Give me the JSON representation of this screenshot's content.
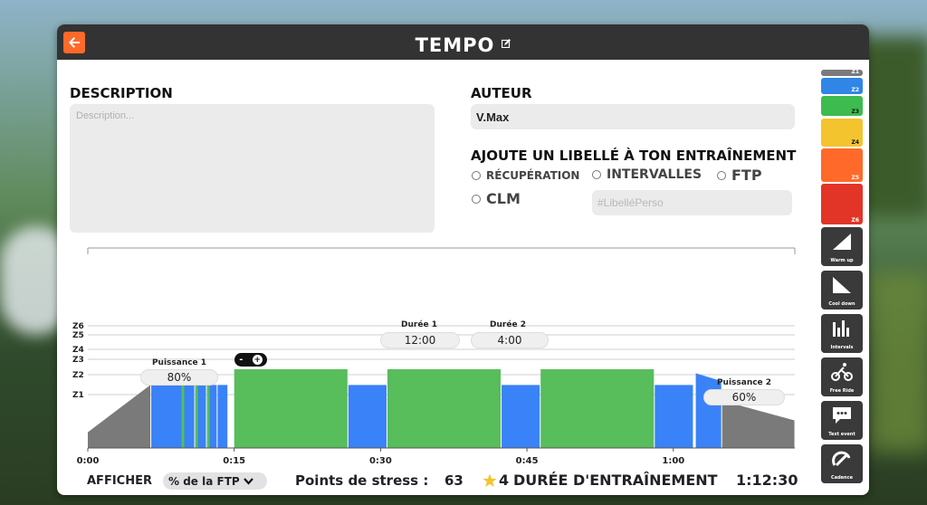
{
  "window": {
    "title": "TEMPO"
  },
  "description": {
    "label": "DESCRIPTION",
    "placeholder": "Description...",
    "value": ""
  },
  "author": {
    "label": "AUTEUR",
    "value": "V.Max"
  },
  "tags": {
    "label": "AJOUTE UN LIBELLÉ À TON ENTRAÎNEMENT",
    "items": [
      "RÉCUPÉRATION",
      "INTERVALLES",
      "FTP",
      "CLM"
    ],
    "custom_placeholder": "#LibelléPerso"
  },
  "chart_data": {
    "type": "area",
    "zones": [
      "Z1",
      "Z2",
      "Z3",
      "Z4",
      "Z5",
      "Z6"
    ],
    "x_ticks": [
      "0:00",
      "0:15",
      "0:30",
      "0:45",
      "1:00"
    ],
    "blocks": [
      {
        "kind": "warmup",
        "start": 0.0,
        "end": 6.5,
        "from": 0.2,
        "to": 0.8,
        "color": "#7a7a7a"
      },
      {
        "kind": "steady",
        "start": 6.5,
        "end": 9.8,
        "power": 0.8,
        "color": "#3a82f7"
      },
      {
        "kind": "steady",
        "start": 9.8,
        "end": 11.0,
        "power": 0.8,
        "color": "#3a82f7"
      },
      {
        "kind": "steady",
        "start": 11.0,
        "end": 12.2,
        "power": 0.8,
        "color": "#3a82f7"
      },
      {
        "kind": "steady",
        "start": 12.2,
        "end": 13.3,
        "power": 0.8,
        "color": "#3a82f7"
      },
      {
        "kind": "steady",
        "start": 13.3,
        "end": 14.4,
        "power": 0.8,
        "color": "#3a82f7"
      },
      {
        "kind": "steady",
        "start": 15.0,
        "end": 26.7,
        "power": 1.0,
        "color": "#58bd5b"
      },
      {
        "kind": "steady",
        "start": 26.7,
        "end": 30.7,
        "power": 0.8,
        "color": "#3a82f7"
      },
      {
        "kind": "steady",
        "start": 30.7,
        "end": 42.4,
        "power": 1.0,
        "color": "#58bd5b"
      },
      {
        "kind": "steady",
        "start": 42.4,
        "end": 46.4,
        "power": 0.8,
        "color": "#3a82f7"
      },
      {
        "kind": "steady",
        "start": 46.4,
        "end": 58.1,
        "power": 1.0,
        "color": "#58bd5b"
      },
      {
        "kind": "steady",
        "start": 58.1,
        "end": 62.1,
        "power": 0.8,
        "color": "#3a82f7"
      },
      {
        "kind": "cooldown_head",
        "start": 62.3,
        "end": 65.0,
        "from": 0.95,
        "to": 0.85,
        "color": "#3a82f7"
      },
      {
        "kind": "cooldown",
        "start": 65.0,
        "end": 72.5,
        "from": 0.6,
        "to": 0.35,
        "color": "#7a7a7a"
      }
    ],
    "annotations": {
      "power1": {
        "title": "Puissance 1",
        "value": "80%"
      },
      "power2": {
        "title": "Puissance 2",
        "value": "60%"
      },
      "duration1": {
        "title": "Durée 1",
        "value": "12:00"
      },
      "duration2": {
        "title": "Durée 2",
        "value": "4:00"
      }
    },
    "zoom": {
      "minus": "-",
      "plus": "+"
    }
  },
  "sidebar": {
    "zones": [
      {
        "label": "Z1",
        "color": "#7a7a7a"
      },
      {
        "label": "Z2",
        "color": "#2f86e6"
      },
      {
        "label": "Z3",
        "color": "#3dbb4f"
      },
      {
        "label": "Z4",
        "color": "#f4c42f"
      },
      {
        "label": "Z5",
        "color": "#ff6a2a"
      },
      {
        "label": "Z6",
        "color": "#e23528"
      }
    ],
    "tools": [
      "Warm up",
      "Cool down",
      "Intervals",
      "Free Ride",
      "Text event",
      "Cadence"
    ]
  },
  "footer": {
    "show_label": "AFFICHER",
    "show_value": "% de la FTP",
    "stress_label": "Points de stress :",
    "stress_value": "63",
    "stars": "4",
    "duration_label": "DURÉE D'ENTRAÎNEMENT",
    "duration_value": "1:12:30"
  },
  "colors": {
    "accent": "#ff6a2a",
    "titlebar": "#333333",
    "blue": "#3a82f7",
    "green": "#58bd5b",
    "gray": "#7a7a7a"
  }
}
